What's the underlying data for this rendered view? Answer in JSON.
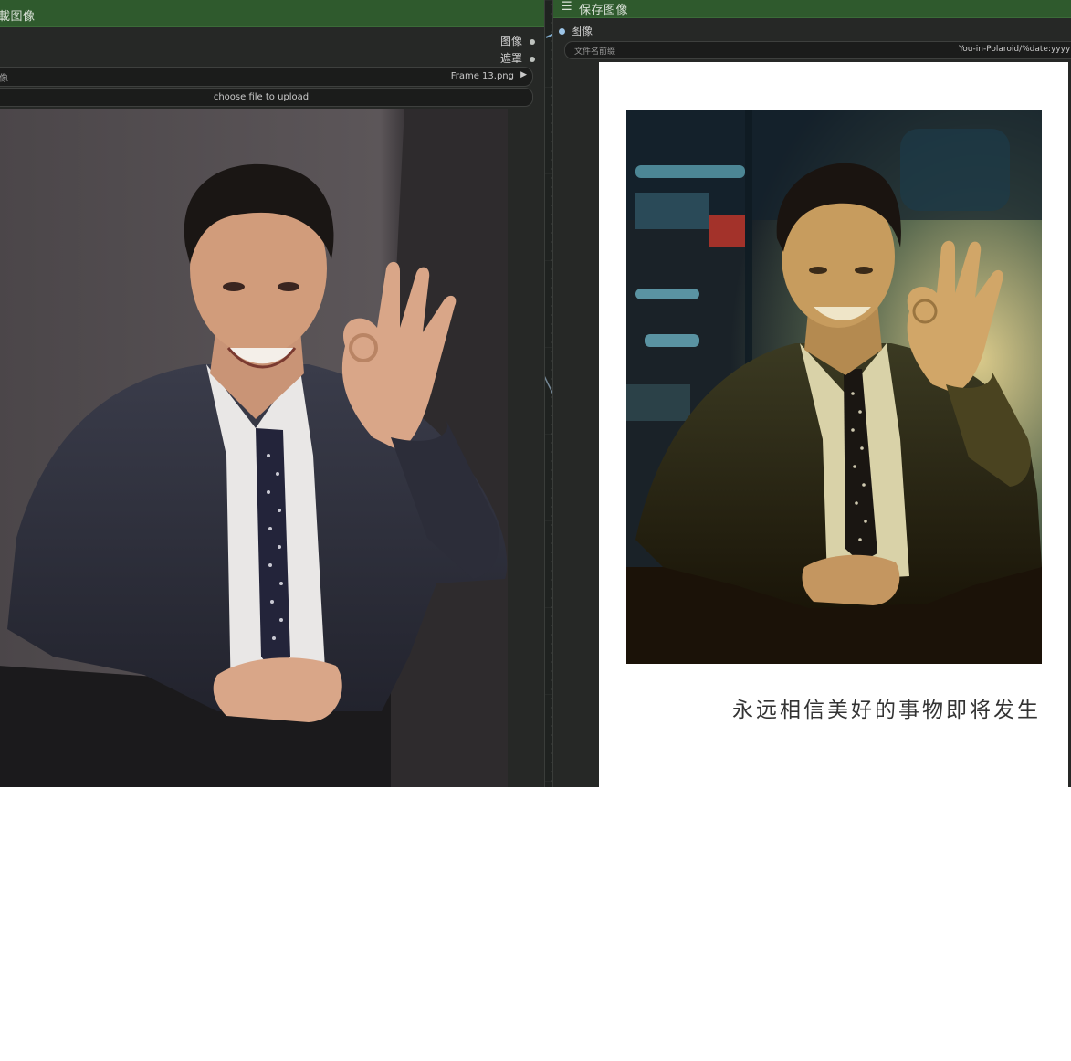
{
  "load_node": {
    "title": "載图像",
    "outputs": [
      {
        "label": "图像"
      },
      {
        "label": "遮罩"
      }
    ],
    "image_widget": {
      "label": "像",
      "value": "Frame 13.png",
      "arrow": "▶"
    },
    "upload_button": "choose file to upload"
  },
  "save_node": {
    "menu_icon": "☰",
    "title": "保存图像",
    "input_label": "图像",
    "filename_widget": {
      "label": "文件名前缀",
      "value": "You-in-Polaroid/%date:yyyy"
    }
  },
  "polaroid": {
    "caption": "永远相信美好的事物即将发生"
  },
  "colors": {
    "node_title_bg": "#2f5a2d",
    "node_bg": "#262826",
    "canvas_bg": "#1f2220",
    "input_dot": "#9dc5e8"
  }
}
